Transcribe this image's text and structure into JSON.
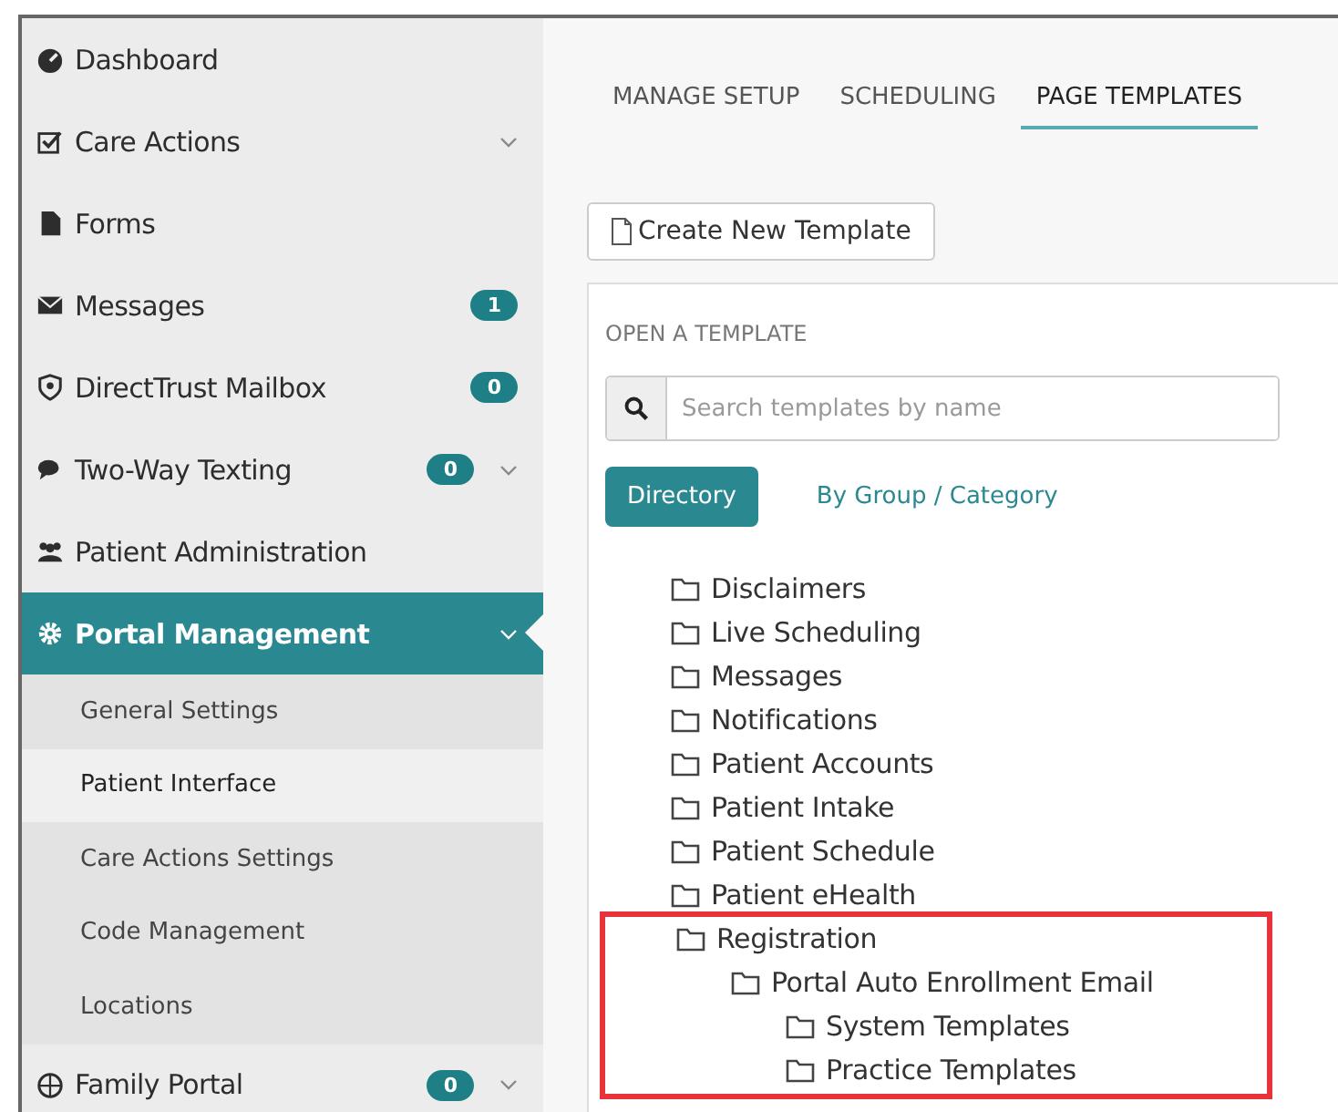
{
  "sidebar": {
    "items": [
      {
        "label": "Dashboard",
        "expandable": false,
        "selected": false
      },
      {
        "label": "Care Actions",
        "expandable": true,
        "selected": false
      },
      {
        "label": "Forms",
        "expandable": false,
        "selected": false
      },
      {
        "label": "Messages",
        "badge": "1",
        "expandable": false,
        "selected": false
      },
      {
        "label": "DirectTrust Mailbox",
        "badge": "0",
        "expandable": false,
        "selected": false
      },
      {
        "label": "Two-Way Texting",
        "badge": "0",
        "expandable": true,
        "selected": false
      },
      {
        "label": "Patient Administration",
        "expandable": false,
        "selected": false
      },
      {
        "label": "Portal Management",
        "expandable": true,
        "selected": true,
        "children": [
          {
            "label": "General Settings",
            "selected": false
          },
          {
            "label": "Patient Interface",
            "selected": true
          },
          {
            "label": "Care Actions Settings",
            "selected": false
          },
          {
            "label": "Code Management",
            "selected": false
          },
          {
            "label": "Locations",
            "selected": false
          }
        ]
      },
      {
        "label": "Family Portal",
        "badge": "0",
        "expandable": true,
        "selected": false
      }
    ]
  },
  "tabs": [
    {
      "label": "MANAGE SETUP",
      "selected": false
    },
    {
      "label": "SCHEDULING",
      "selected": false
    },
    {
      "label": "PAGE TEMPLATES",
      "selected": true
    }
  ],
  "create_button": "Create New Template",
  "panel": {
    "title": "OPEN A TEMPLATE",
    "search": {
      "placeholder": "Search templates by name"
    },
    "views": [
      {
        "label": "Directory",
        "selected": true
      },
      {
        "label": "By Group / Category",
        "selected": false
      }
    ],
    "tree": [
      {
        "label": "Disclaimers",
        "highlighted": false
      },
      {
        "label": "Live Scheduling",
        "highlighted": false
      },
      {
        "label": "Messages",
        "highlighted": false
      },
      {
        "label": "Notifications",
        "highlighted": false
      },
      {
        "label": "Patient Accounts",
        "highlighted": false
      },
      {
        "label": "Patient Intake",
        "highlighted": false
      },
      {
        "label": "Patient Schedule",
        "highlighted": false
      },
      {
        "label": "Patient eHealth",
        "highlighted": false
      },
      {
        "label": "Registration",
        "highlighted": true,
        "children": [
          {
            "label": "Portal Auto Enrollment Email",
            "children": [
              {
                "label": "System Templates"
              },
              {
                "label": "Practice Templates"
              }
            ]
          }
        ]
      }
    ]
  }
}
